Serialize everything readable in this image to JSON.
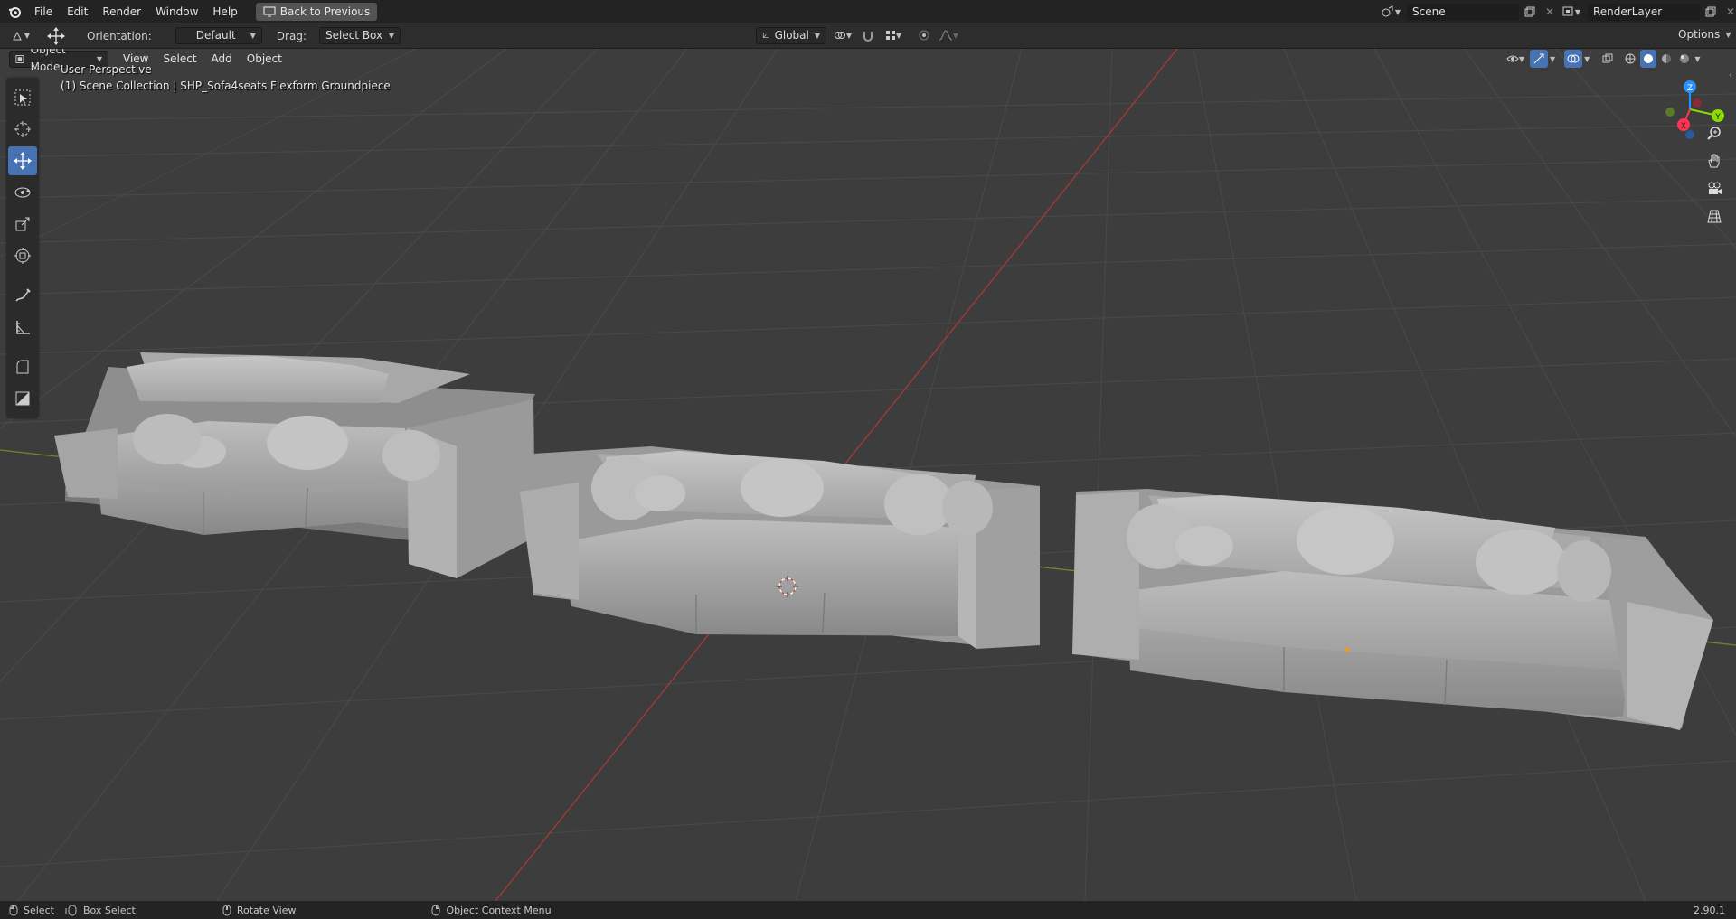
{
  "topbar": {
    "menus": [
      "File",
      "Edit",
      "Render",
      "Window",
      "Help"
    ],
    "back_button": "Back to Previous",
    "scene_name": "Scene",
    "render_layer": "RenderLayer"
  },
  "tool_settings": {
    "orientation_label": "Orientation:",
    "orientation_value": "Default",
    "drag_label": "Drag:",
    "drag_value": "Select Box",
    "transform_orientation": "Global",
    "options_label": "Options"
  },
  "header": {
    "mode": "Object Mode",
    "menus": [
      "View",
      "Select",
      "Add",
      "Object"
    ]
  },
  "viewport": {
    "view_name": "User Perspective",
    "collection_info": "(1) Scene Collection | SHP_Sofa4seats Flexform Groundpiece",
    "gizmo_axes": {
      "x": "X",
      "y": "Y",
      "z": "Z"
    }
  },
  "toolbar": {
    "tools": [
      "select-box",
      "cursor",
      "move",
      "rotate",
      "scale",
      "transform",
      "annotate",
      "measure",
      "add-cube",
      "add-plane"
    ],
    "active_tool": "move"
  },
  "statusbar": {
    "select": "Select",
    "box_select": "Box Select",
    "rotate_view": "Rotate View",
    "context_menu": "Object Context Menu",
    "version": "2.90.1"
  },
  "colors": {
    "accent": "#4772b3",
    "x_axis": "#ff3352",
    "y_axis": "#8bdc00",
    "z_axis": "#2890ff",
    "grid_red": "#9b3a3a",
    "grid_green": "#6a8a28"
  }
}
